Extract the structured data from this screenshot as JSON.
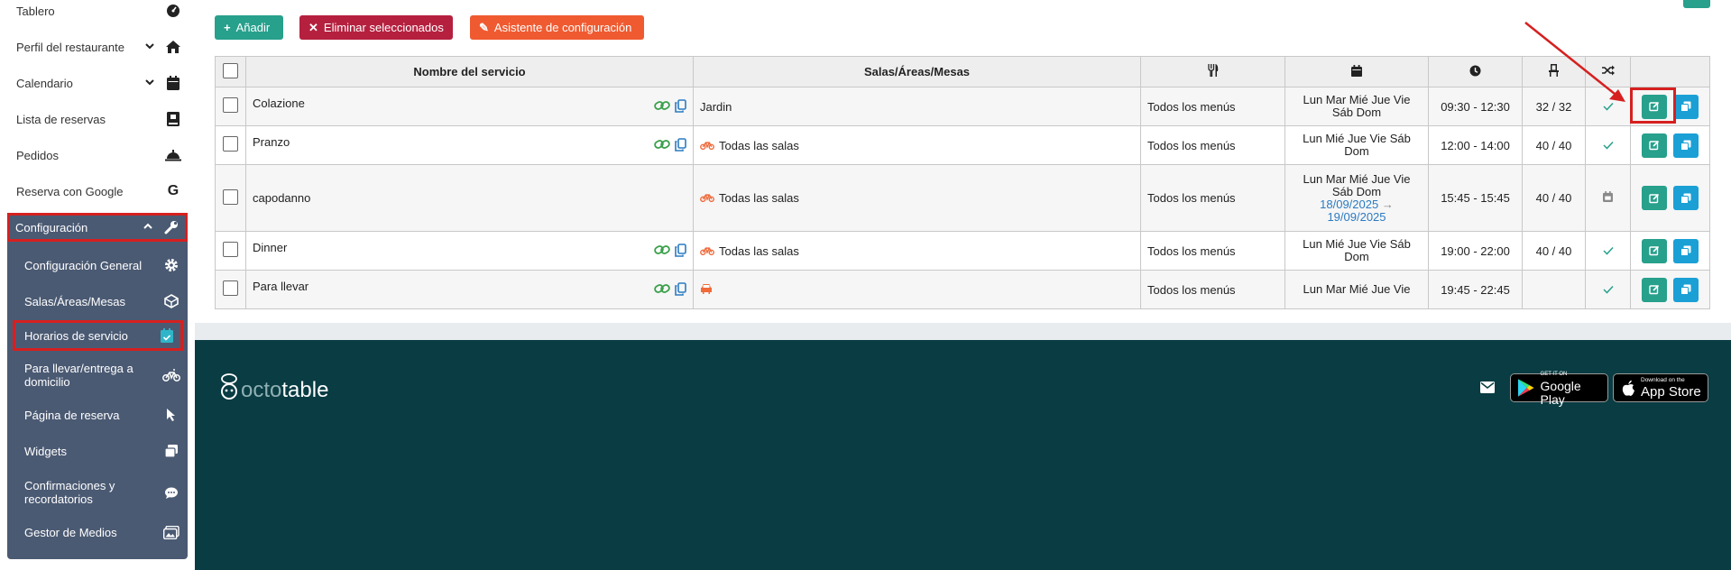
{
  "sidebar": {
    "items": [
      {
        "label": "Tablero"
      },
      {
        "label": "Perfil del restaurante"
      },
      {
        "label": "Calendario"
      },
      {
        "label": "Lista de reservas"
      },
      {
        "label": "Pedidos"
      },
      {
        "label": "Reserva con Google"
      },
      {
        "label": "Configuración"
      }
    ],
    "submenu": [
      {
        "label": "Configuración General"
      },
      {
        "label": "Salas/Áreas/Mesas"
      },
      {
        "label": "Horarios de servicio"
      },
      {
        "label": "Para llevar/entrega a domicilio"
      },
      {
        "label": "Página de reserva"
      },
      {
        "label": "Widgets"
      },
      {
        "label": "Confirmaciones y recordatorios"
      },
      {
        "label": "Gestor de Medios"
      }
    ]
  },
  "toolbar": {
    "add_label": "Añadir",
    "delete_label": "Eliminar seleccionados",
    "wizard_label": "Asistente de configuración"
  },
  "table": {
    "headers": {
      "name": "Nombre del servicio",
      "rooms": "Salas/Áreas/Mesas"
    },
    "rows": [
      {
        "name": "Colazione",
        "rooms": "Jardin",
        "menu": "Todos los menús",
        "days": "Lun Mar Mié Jue Vie Sáb Dom",
        "date_from": "",
        "date_to": "",
        "hours": "09:30 - 12:30",
        "capacity": "32 / 32",
        "status": "check"
      },
      {
        "name": "Pranzo",
        "rooms": "Todas las salas",
        "menu": "Todos los menús",
        "days": "Lun Mié Jue Vie Sáb Dom",
        "date_from": "",
        "date_to": "",
        "hours": "12:00 - 14:00",
        "capacity": "40 / 40",
        "status": "check"
      },
      {
        "name": "capodanno",
        "rooms": "Todas las salas",
        "menu": "Todos los menús",
        "days": "Lun Mar Mié Jue Vie Sáb Dom",
        "date_from": "18/09/2025",
        "date_to": "19/09/2025",
        "hours": "15:45 - 15:45",
        "capacity": "40 / 40",
        "status": "calendar"
      },
      {
        "name": "Dinner",
        "rooms": "Todas las salas",
        "menu": "Todos los menús",
        "days": "Lun Mié Jue Vie Sáb Dom",
        "date_from": "",
        "date_to": "",
        "hours": "19:00 - 22:00",
        "capacity": "40 / 40",
        "status": "check"
      },
      {
        "name": "Para llevar",
        "rooms": "",
        "menu": "Todos los menús",
        "days": "Lun Mar Mié Jue Vie",
        "date_from": "",
        "date_to": "",
        "hours": "19:45 - 22:45",
        "capacity": "",
        "status": "check"
      }
    ]
  },
  "footer": {
    "logo_left": "octo",
    "logo_right": "table",
    "google_play_small": "GET IT ON",
    "google_play_big": "Google Play",
    "app_store_small": "Download on the",
    "app_store_big": "App Store"
  },
  "colors": {
    "add": "#27a08c",
    "delete": "#b5203f",
    "wizard": "#f05a30",
    "highlight": "#d62020",
    "footer": "#093c43",
    "sidebar_active": "#4b5a73"
  }
}
